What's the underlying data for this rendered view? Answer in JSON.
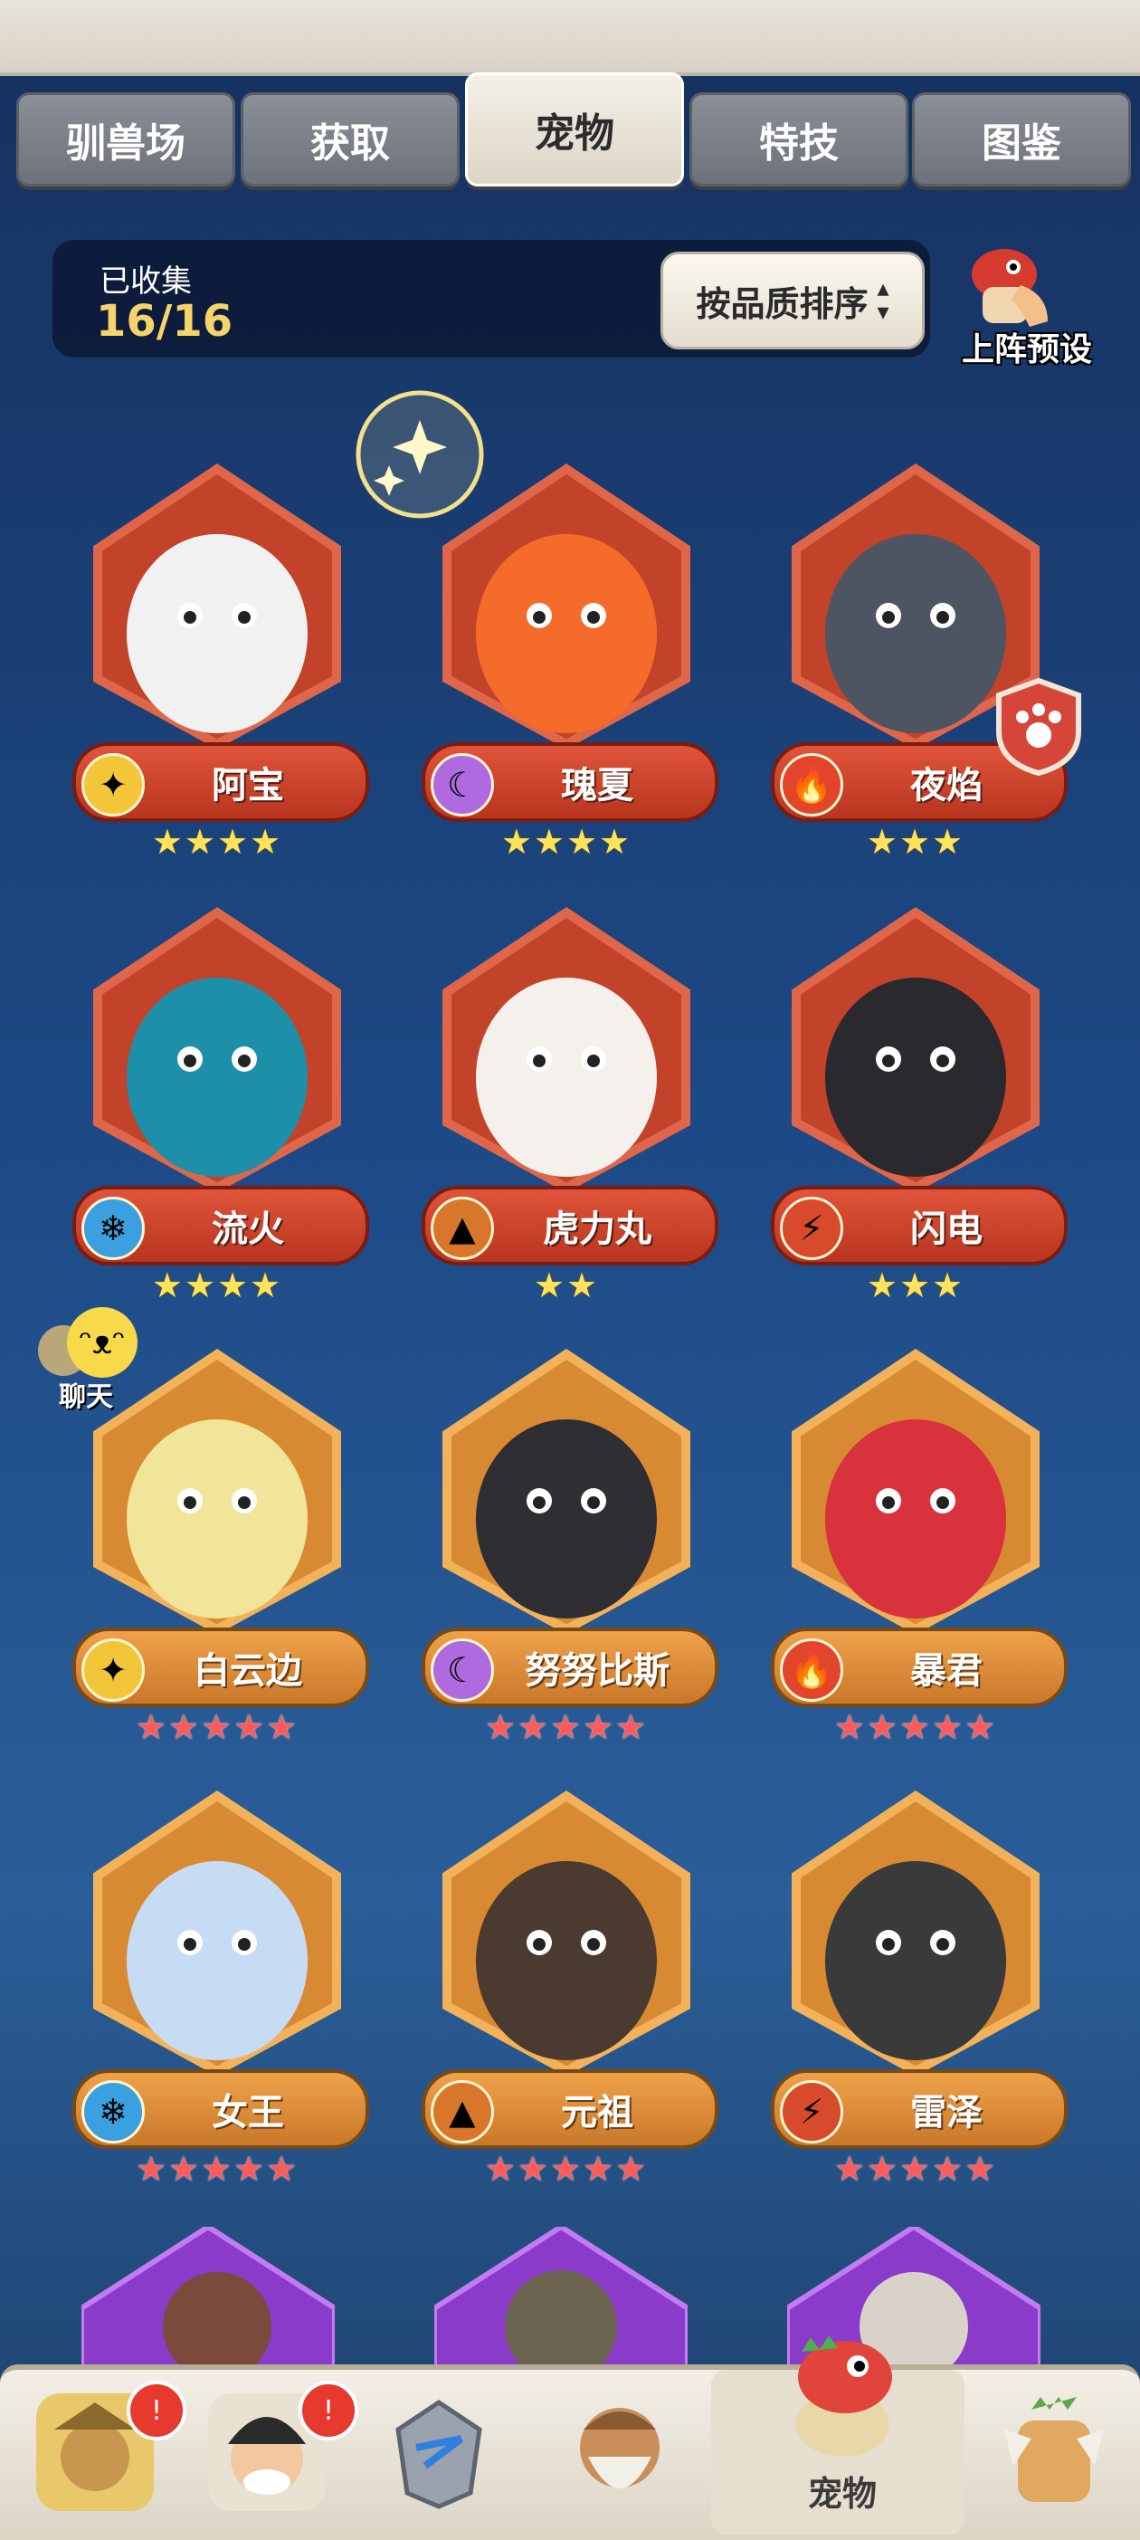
{
  "tabs": [
    {
      "label": "驯兽场",
      "active": false
    },
    {
      "label": "获取",
      "active": false
    },
    {
      "label": "宠物",
      "active": true
    },
    {
      "label": "特技",
      "active": false
    },
    {
      "label": "图鉴",
      "active": false
    }
  ],
  "collection": {
    "label": "已收集",
    "value": "16/16"
  },
  "sort_button": {
    "label": "按品质排序"
  },
  "preset_button": {
    "label": "上阵预设"
  },
  "pets": [
    {
      "name": "阿宝",
      "element": "light-icon",
      "stars": "★★★★",
      "star_color": "yellow"
    },
    {
      "name": "瑰夏",
      "element": "moon-icon",
      "stars": "★★★★",
      "star_color": "yellow"
    },
    {
      "name": "夜焰",
      "element": "fire-icon",
      "stars": "★★★",
      "star_color": "yellow"
    },
    {
      "name": "流火",
      "element": "ice-icon",
      "stars": "★★★★",
      "star_color": "yellow"
    },
    {
      "name": "虎力丸",
      "element": "earth-icon",
      "stars": "★★",
      "star_color": "yellow"
    },
    {
      "name": "闪电",
      "element": "lightning-icon",
      "stars": "★★★",
      "star_color": "yellow"
    },
    {
      "name": "白云边",
      "element": "light-icon",
      "stars": "★★★★★",
      "star_color": "red"
    },
    {
      "name": "努努比斯",
      "element": "moon-icon",
      "stars": "★★★★★",
      "star_color": "red"
    },
    {
      "name": "暴君",
      "element": "fire-icon",
      "stars": "★★★★★",
      "star_color": "red"
    },
    {
      "name": "女王",
      "element": "ice-icon",
      "stars": "★★★★★",
      "star_color": "red"
    },
    {
      "name": "元祖",
      "element": "earth-icon",
      "stars": "★★★★★",
      "star_color": "red"
    },
    {
      "name": "雷泽",
      "element": "lightning-icon",
      "stars": "★★★★★",
      "star_color": "red"
    }
  ],
  "chat": {
    "label": "聊天"
  },
  "bottom_nav": [
    {
      "icon": "hunter-avatar-icon",
      "badge": true
    },
    {
      "icon": "boy-avatar-icon",
      "badge": true
    },
    {
      "icon": "armor-icon",
      "badge": false
    },
    {
      "icon": "elder-avatar-icon",
      "badge": false
    },
    {
      "icon": "pet-dino-icon",
      "label": "宠物",
      "active": true
    },
    {
      "icon": "totem-icon",
      "badge": false
    }
  ],
  "colors": {
    "accent_gold": "#f6d36b",
    "red_frame": "#c2432a",
    "gold_frame": "#d88a33",
    "badge": "#e53a2d"
  }
}
